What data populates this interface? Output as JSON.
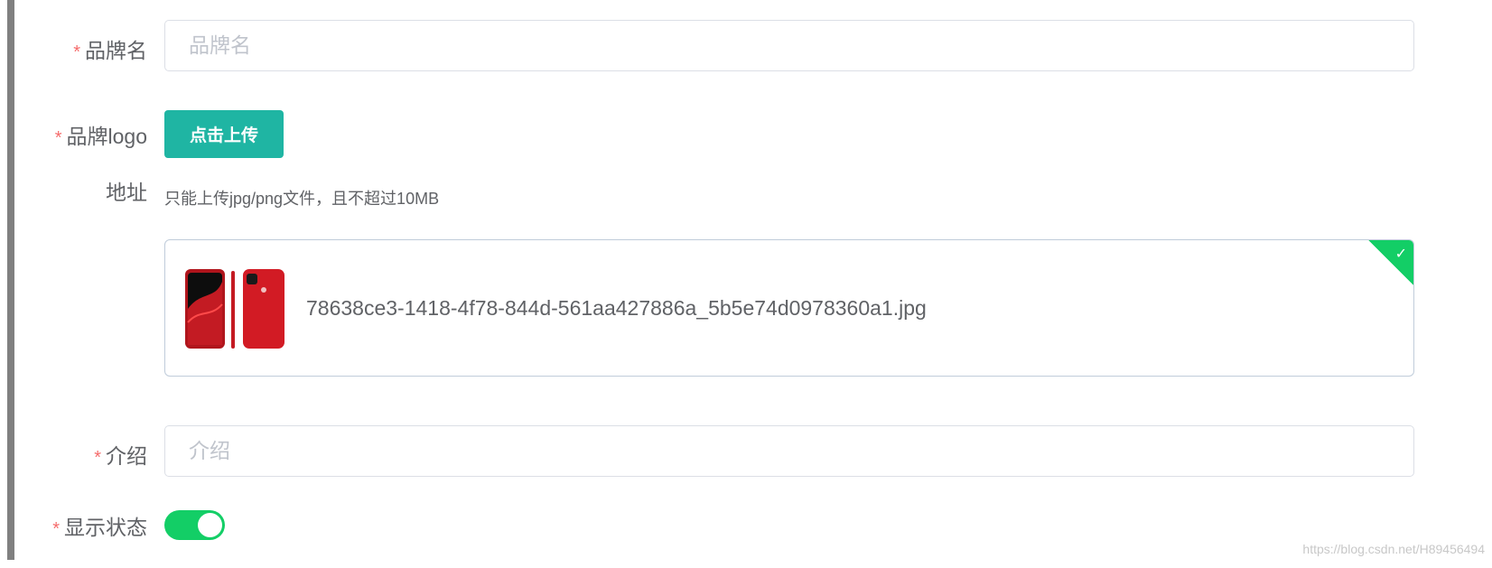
{
  "form": {
    "brand_name": {
      "required_mark": "*",
      "label": "品牌名",
      "placeholder": "品牌名",
      "value": ""
    },
    "brand_logo": {
      "required_mark": "*",
      "label_line1": "品牌logo",
      "label_line2": "地址",
      "upload_button": "点击上传",
      "tip": "只能上传jpg/png文件，且不超过10MB",
      "file": {
        "name": "78638ce3-1418-4f78-844d-561aa427886a_5b5e74d0978360a1.jpg",
        "status": "success"
      }
    },
    "description": {
      "required_mark": "*",
      "label": "介绍",
      "placeholder": "介绍",
      "value": ""
    },
    "show_status": {
      "required_mark": "*",
      "label": "显示状态",
      "enabled": true
    }
  },
  "colors": {
    "primary_button": "#1fb5a3",
    "success": "#13ce66",
    "required": "#f56c6c"
  },
  "icons": {
    "upload_status": "check-icon"
  },
  "watermark": "https://blog.csdn.net/H89456494"
}
